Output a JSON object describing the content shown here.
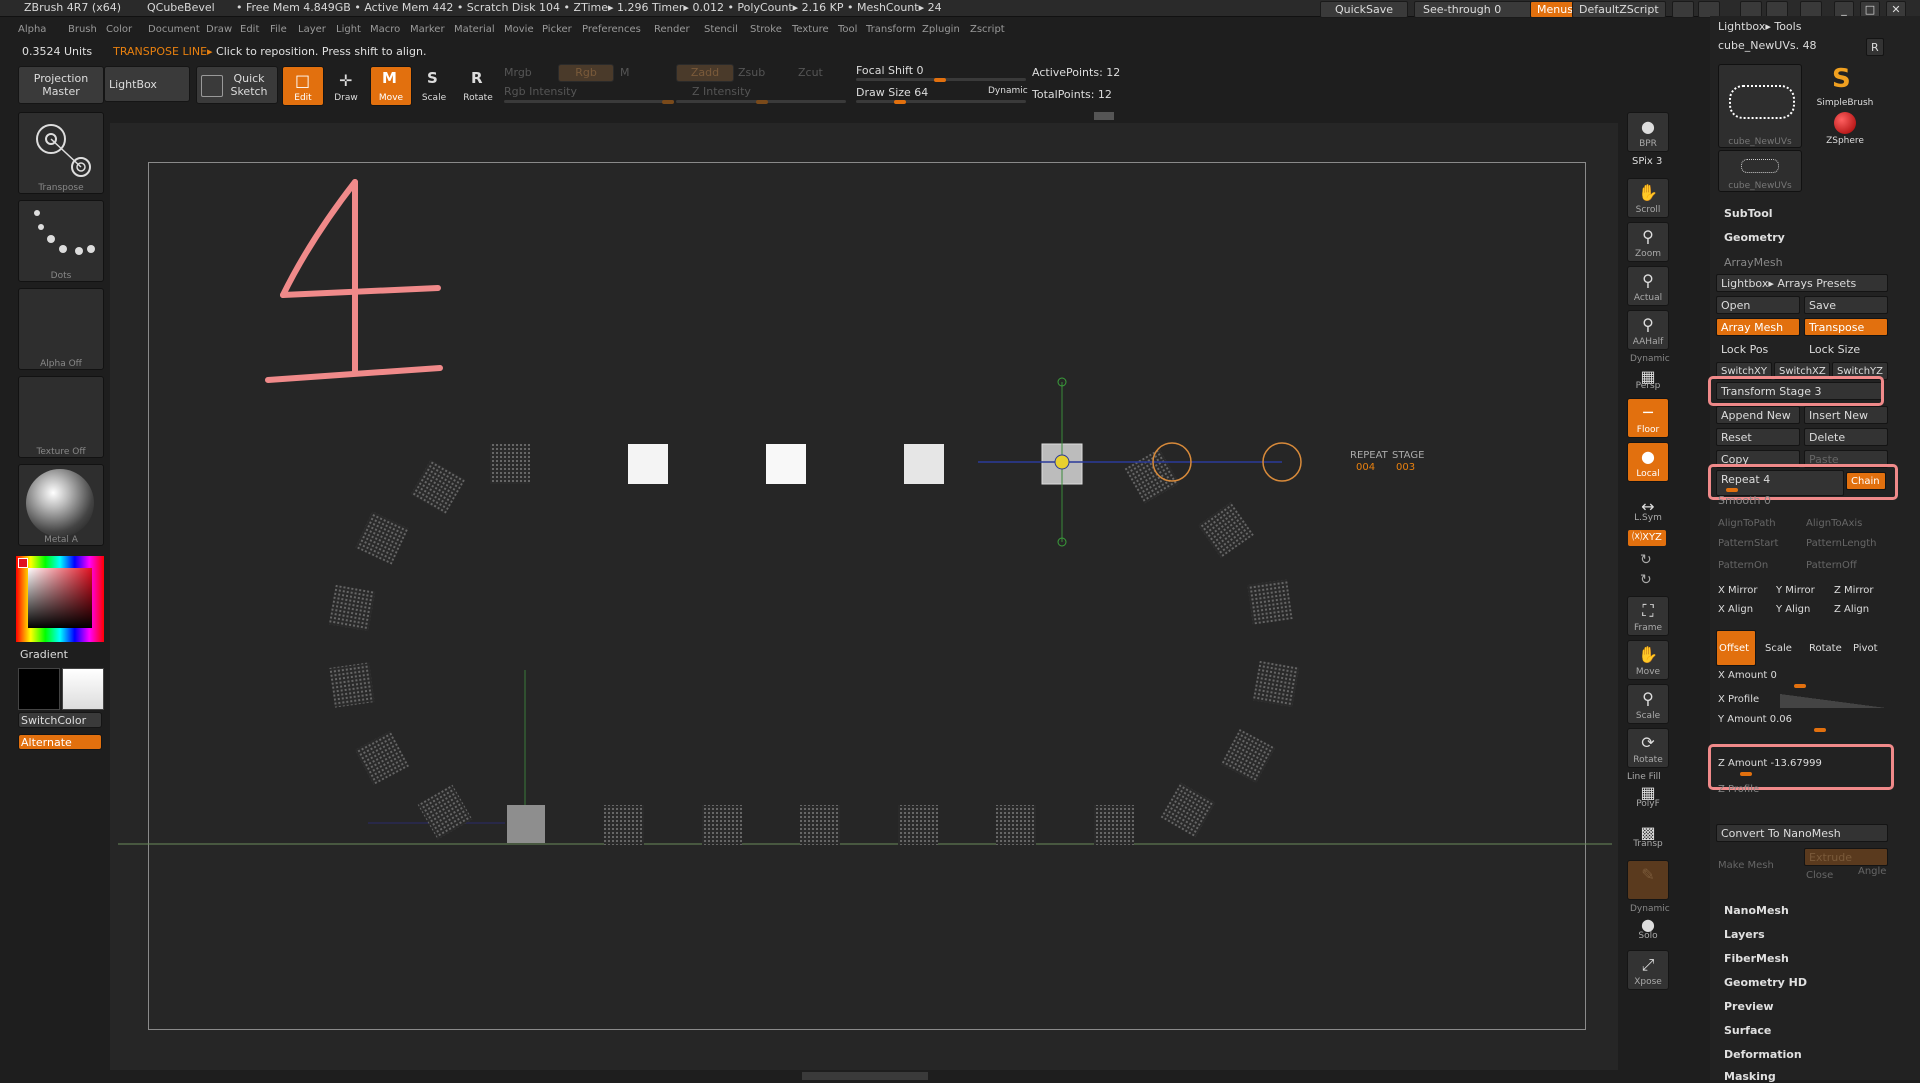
{
  "title_bar": {
    "app": "ZBrush 4R7 (x64)",
    "tool": "QCubeBevel",
    "stats": "• Free Mem 4.849GB • Active Mem 442 • Scratch Disk 104 •   ZTime▸ 1.296  Timer▸ 0.012 • PolyCount▸ 2.16 KP  • MeshCount▸ 24",
    "quicksave": "QuickSave",
    "see_through": "See-through  0",
    "menus": "Menus",
    "default_zscript": "DefaultZScript"
  },
  "menu_bar": [
    "Alpha",
    "Brush",
    "Color",
    "Document",
    "Draw",
    "Edit",
    "File",
    "Layer",
    "Light",
    "Macro",
    "Marker",
    "Material",
    "Movie",
    "Picker",
    "Preferences",
    "Render",
    "Stencil",
    "Stroke",
    "Texture",
    "Tool",
    "Transform",
    "Zplugin",
    "Zscript"
  ],
  "status": {
    "units": "0.3524 Units",
    "mode": "TRANSPOSE LINE▸",
    "hint": "Click to reposition. Press shift to align."
  },
  "shelf": {
    "projection_master": "Projection Master",
    "lightbox": "LightBox",
    "quick_sketch": "Quick Sketch",
    "edit": "Edit",
    "draw": "Draw",
    "move": "Move",
    "scale": "Scale",
    "rotate": "Rotate",
    "mrgb": "Mrgb",
    "rgb": "Rgb",
    "m": "M",
    "rgb_intensity": "Rgb Intensity",
    "zadd": "Zadd",
    "zsub": "Zsub",
    "zcut": "Zcut",
    "z_intensity": "Z Intensity",
    "focal_shift": "Focal Shift 0",
    "draw_size": "Draw Size 64",
    "dynamic": "Dynamic",
    "active_points": "ActivePoints: 12",
    "total_points": "TotalPoints: 12"
  },
  "left_shelf": {
    "transpose": "Transpose",
    "dots": "Dots",
    "alpha_off": "Alpha Off",
    "texture_off": "Texture Off",
    "metal": "Metal A",
    "gradient": "Gradient",
    "switch_color": "SwitchColor",
    "alternate": "Alternate"
  },
  "viewport": {
    "step_number": "4",
    "repeat_label": "REPEAT",
    "repeat_value": "004",
    "stage_label": "STAGE",
    "stage_value": "003"
  },
  "right_shelf": {
    "bpr": "BPR",
    "spix": "SPix 3",
    "scroll": "Scroll",
    "zoom": "Zoom",
    "actual": "Actual",
    "aahalf": "AAHalf",
    "dynamic": "Dynamic",
    "persp": "Persp",
    "floor": "Floor",
    "local": "Local",
    "lsym": "L.Sym",
    "xyz": "⒳XYZ",
    "frame": "Frame",
    "move": "Move",
    "scale": "Scale",
    "rotate": "Rotate",
    "line_fill": "Line Fill",
    "polyf": "PolyF",
    "transp": "Transp",
    "dynamic2": "Dynamic",
    "solo": "Solo",
    "xpose": "Xpose"
  },
  "tool_panel": {
    "lightbox_tools": "Lightbox▸ Tools",
    "current_tool": "cube_NewUVs. 48",
    "r": "R",
    "simple_brush": "SimpleBrush",
    "zsphere": "ZSphere",
    "thumb1": "cube_NewUVs",
    "thumb2": "cube_NewUVs",
    "subtool": "SubTool",
    "geometry": "Geometry",
    "arraymesh": "ArrayMesh",
    "arrays_presets": "Lightbox▸ Arrays Presets",
    "open": "Open",
    "save": "Save",
    "array_mesh": "Array Mesh",
    "transpose": "Transpose",
    "lock_pos": "Lock Pos",
    "lock_size": "Lock Size",
    "switchxy": "SwitchXY",
    "switchxz": "SwitchXZ",
    "switchyz": "SwitchYZ",
    "transform_stage": "Transform Stage 3",
    "append_new": "Append New",
    "insert_new": "Insert New",
    "reset": "Reset",
    "delete": "Delete",
    "copy": "Copy",
    "paste": "Paste",
    "repeat": "Repeat 4",
    "chain": "Chain",
    "smooth": "Smooth 0",
    "align_to_path": "AlignToPath",
    "align_to_axis": "AlignToAxis",
    "pattern_start": "PatternStart",
    "pattern_length": "PatternLength",
    "pattern_on": "PatternOn",
    "pattern_off": "PatternOff",
    "x_mirror": "X Mirror",
    "y_mirror": "Y Mirror",
    "z_mirror": "Z Mirror",
    "x_align": "X Align",
    "y_align": "Y Align",
    "z_align": "Z Align",
    "offset": "Offset",
    "scale": "Scale",
    "rotate": "Rotate",
    "pivot": "Pivot",
    "x_amount": "X Amount 0",
    "x_profile": "X Profile",
    "y_amount": "Y Amount 0.06",
    "z_amount": "Z Amount -13.67999",
    "z_profile": "Z Profile",
    "convert_nanomesh": "Convert To NanoMesh",
    "extrude": "Extrude",
    "make_mesh": "Make Mesh",
    "close": "Close",
    "angle": "Angle",
    "nanomesh": "NanoMesh",
    "layers": "Layers",
    "fibermesh": "FiberMesh",
    "geometry_hd": "Geometry HD",
    "preview": "Preview",
    "surface": "Surface",
    "deformation": "Deformation",
    "masking": "Masking"
  },
  "colors": {
    "accent": "#e2700e",
    "highlight": "#f08a8a",
    "background": "#1e1e1e"
  }
}
